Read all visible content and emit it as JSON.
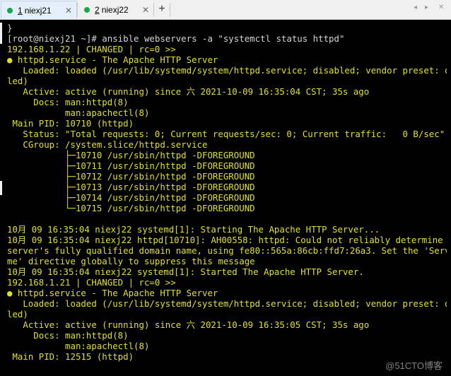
{
  "tabs": [
    {
      "number": "1",
      "title": "niexj21",
      "active": true,
      "status_color": "#13a84a"
    },
    {
      "number": "2",
      "title": "niexj22",
      "active": false,
      "status_color": "#13a84a"
    }
  ],
  "new_tab_label": "+",
  "close_glyph": "✕",
  "window_controls": [
    "◂",
    "▸",
    "✕"
  ],
  "terminal": {
    "foreground_yellow": "#e0e020",
    "foreground_white": "#d4d4d4",
    "lines": [
      "}",
      "[root@niexj21 ~]# ansible webservers -a \"systemctl status httpd\"",
      "192.168.1.22 | CHANGED | rc=0 >>",
      "● httpd.service - The Apache HTTP Server",
      "   Loaded: loaded (/usr/lib/systemd/system/httpd.service; disabled; vendor preset: disab",
      "led)",
      "   Active: active (running) since 六 2021-10-09 16:35:04 CST; 35s ago",
      "     Docs: man:httpd(8)",
      "           man:apachectl(8)",
      " Main PID: 10710 (httpd)",
      "   Status: \"Total requests: 0; Current requests/sec: 0; Current traffic:   0 B/sec\"",
      "   CGroup: /system.slice/httpd.service",
      "           ├─10710 /usr/sbin/httpd -DFOREGROUND",
      "           ├─10711 /usr/sbin/httpd -DFOREGROUND",
      "           ├─10712 /usr/sbin/httpd -DFOREGROUND",
      "           ├─10713 /usr/sbin/httpd -DFOREGROUND",
      "           ├─10714 /usr/sbin/httpd -DFOREGROUND",
      "           └─10715 /usr/sbin/httpd -DFOREGROUND",
      "",
      "10月 09 16:35:04 niexj22 systemd[1]: Starting The Apache HTTP Server...",
      "10月 09 16:35:04 niexj22 httpd[10710]: AH00558: httpd: Could not reliably determine the",
      "server's fully qualified domain name, using fe80::565a:86cb:ffd7:26a3. Set the 'ServerNa",
      "me' directive globally to suppress this message",
      "10月 09 16:35:04 niexj22 systemd[1]: Started The Apache HTTP Server.",
      "192.168.1.21 | CHANGED | rc=0 >>",
      "● httpd.service - The Apache HTTP Server",
      "   Loaded: loaded (/usr/lib/systemd/system/httpd.service; disabled; vendor preset: disab",
      "led)",
      "   Active: active (running) since 六 2021-10-09 16:35:05 CST; 35s ago",
      "     Docs: man:httpd(8)",
      "           man:apachectl(8)",
      " Main PID: 12515 (httpd)"
    ]
  },
  "watermark": "@51CTO博客"
}
